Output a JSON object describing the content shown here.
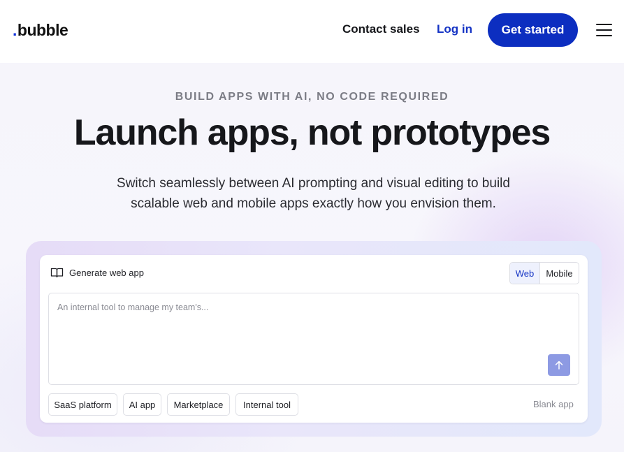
{
  "header": {
    "logo_dot": ".",
    "logo_text": "bubble",
    "contact_sales": "Contact sales",
    "log_in": "Log in",
    "get_started": "Get started"
  },
  "hero": {
    "eyebrow": "BUILD APPS WITH AI, NO CODE REQUIRED",
    "headline": "Launch apps, not prototypes",
    "subtitle": "Switch seamlessly between AI prompting and visual editing to build scalable web and mobile apps exactly how you envision them."
  },
  "generator": {
    "title": "Generate web app",
    "title_icon": "book-open-icon",
    "platform_options": [
      "Web",
      "Mobile"
    ],
    "selected_platform": "Web",
    "prompt_placeholder": "An internal tool to manage my team's...",
    "prompt_value": "",
    "send_icon": "arrow-up-icon",
    "suggestions": [
      "SaaS platform",
      "AI app",
      "Marketplace",
      "Internal tool"
    ],
    "blank_app": "Blank app"
  },
  "colors": {
    "brand_blue": "#0c2ec0",
    "link_blue": "#1332c4",
    "send_button": "#8d9ae3",
    "text_dark": "#16171b",
    "eyebrow_gray": "#7b7c85"
  }
}
